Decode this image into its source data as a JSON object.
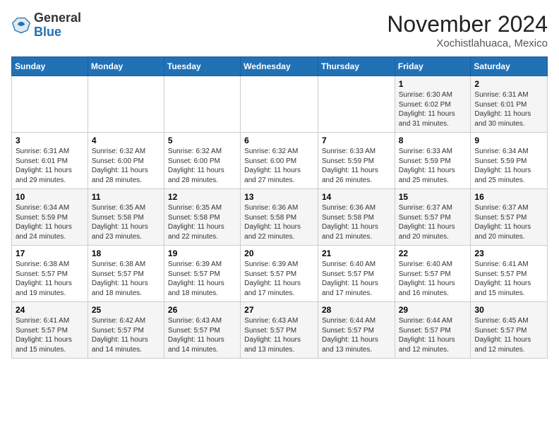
{
  "header": {
    "logo_general": "General",
    "logo_blue": "Blue",
    "month_title": "November 2024",
    "location": "Xochistlahuaca, Mexico"
  },
  "days_of_week": [
    "Sunday",
    "Monday",
    "Tuesday",
    "Wednesday",
    "Thursday",
    "Friday",
    "Saturday"
  ],
  "weeks": [
    [
      {
        "day": "",
        "info": ""
      },
      {
        "day": "",
        "info": ""
      },
      {
        "day": "",
        "info": ""
      },
      {
        "day": "",
        "info": ""
      },
      {
        "day": "",
        "info": ""
      },
      {
        "day": "1",
        "info": "Sunrise: 6:30 AM\nSunset: 6:02 PM\nDaylight: 11 hours and 31 minutes."
      },
      {
        "day": "2",
        "info": "Sunrise: 6:31 AM\nSunset: 6:01 PM\nDaylight: 11 hours and 30 minutes."
      }
    ],
    [
      {
        "day": "3",
        "info": "Sunrise: 6:31 AM\nSunset: 6:01 PM\nDaylight: 11 hours and 29 minutes."
      },
      {
        "day": "4",
        "info": "Sunrise: 6:32 AM\nSunset: 6:00 PM\nDaylight: 11 hours and 28 minutes."
      },
      {
        "day": "5",
        "info": "Sunrise: 6:32 AM\nSunset: 6:00 PM\nDaylight: 11 hours and 28 minutes."
      },
      {
        "day": "6",
        "info": "Sunrise: 6:32 AM\nSunset: 6:00 PM\nDaylight: 11 hours and 27 minutes."
      },
      {
        "day": "7",
        "info": "Sunrise: 6:33 AM\nSunset: 5:59 PM\nDaylight: 11 hours and 26 minutes."
      },
      {
        "day": "8",
        "info": "Sunrise: 6:33 AM\nSunset: 5:59 PM\nDaylight: 11 hours and 25 minutes."
      },
      {
        "day": "9",
        "info": "Sunrise: 6:34 AM\nSunset: 5:59 PM\nDaylight: 11 hours and 25 minutes."
      }
    ],
    [
      {
        "day": "10",
        "info": "Sunrise: 6:34 AM\nSunset: 5:59 PM\nDaylight: 11 hours and 24 minutes."
      },
      {
        "day": "11",
        "info": "Sunrise: 6:35 AM\nSunset: 5:58 PM\nDaylight: 11 hours and 23 minutes."
      },
      {
        "day": "12",
        "info": "Sunrise: 6:35 AM\nSunset: 5:58 PM\nDaylight: 11 hours and 22 minutes."
      },
      {
        "day": "13",
        "info": "Sunrise: 6:36 AM\nSunset: 5:58 PM\nDaylight: 11 hours and 22 minutes."
      },
      {
        "day": "14",
        "info": "Sunrise: 6:36 AM\nSunset: 5:58 PM\nDaylight: 11 hours and 21 minutes."
      },
      {
        "day": "15",
        "info": "Sunrise: 6:37 AM\nSunset: 5:57 PM\nDaylight: 11 hours and 20 minutes."
      },
      {
        "day": "16",
        "info": "Sunrise: 6:37 AM\nSunset: 5:57 PM\nDaylight: 11 hours and 20 minutes."
      }
    ],
    [
      {
        "day": "17",
        "info": "Sunrise: 6:38 AM\nSunset: 5:57 PM\nDaylight: 11 hours and 19 minutes."
      },
      {
        "day": "18",
        "info": "Sunrise: 6:38 AM\nSunset: 5:57 PM\nDaylight: 11 hours and 18 minutes."
      },
      {
        "day": "19",
        "info": "Sunrise: 6:39 AM\nSunset: 5:57 PM\nDaylight: 11 hours and 18 minutes."
      },
      {
        "day": "20",
        "info": "Sunrise: 6:39 AM\nSunset: 5:57 PM\nDaylight: 11 hours and 17 minutes."
      },
      {
        "day": "21",
        "info": "Sunrise: 6:40 AM\nSunset: 5:57 PM\nDaylight: 11 hours and 17 minutes."
      },
      {
        "day": "22",
        "info": "Sunrise: 6:40 AM\nSunset: 5:57 PM\nDaylight: 11 hours and 16 minutes."
      },
      {
        "day": "23",
        "info": "Sunrise: 6:41 AM\nSunset: 5:57 PM\nDaylight: 11 hours and 15 minutes."
      }
    ],
    [
      {
        "day": "24",
        "info": "Sunrise: 6:41 AM\nSunset: 5:57 PM\nDaylight: 11 hours and 15 minutes."
      },
      {
        "day": "25",
        "info": "Sunrise: 6:42 AM\nSunset: 5:57 PM\nDaylight: 11 hours and 14 minutes."
      },
      {
        "day": "26",
        "info": "Sunrise: 6:43 AM\nSunset: 5:57 PM\nDaylight: 11 hours and 14 minutes."
      },
      {
        "day": "27",
        "info": "Sunrise: 6:43 AM\nSunset: 5:57 PM\nDaylight: 11 hours and 13 minutes."
      },
      {
        "day": "28",
        "info": "Sunrise: 6:44 AM\nSunset: 5:57 PM\nDaylight: 11 hours and 13 minutes."
      },
      {
        "day": "29",
        "info": "Sunrise: 6:44 AM\nSunset: 5:57 PM\nDaylight: 11 hours and 12 minutes."
      },
      {
        "day": "30",
        "info": "Sunrise: 6:45 AM\nSunset: 5:57 PM\nDaylight: 11 hours and 12 minutes."
      }
    ]
  ]
}
